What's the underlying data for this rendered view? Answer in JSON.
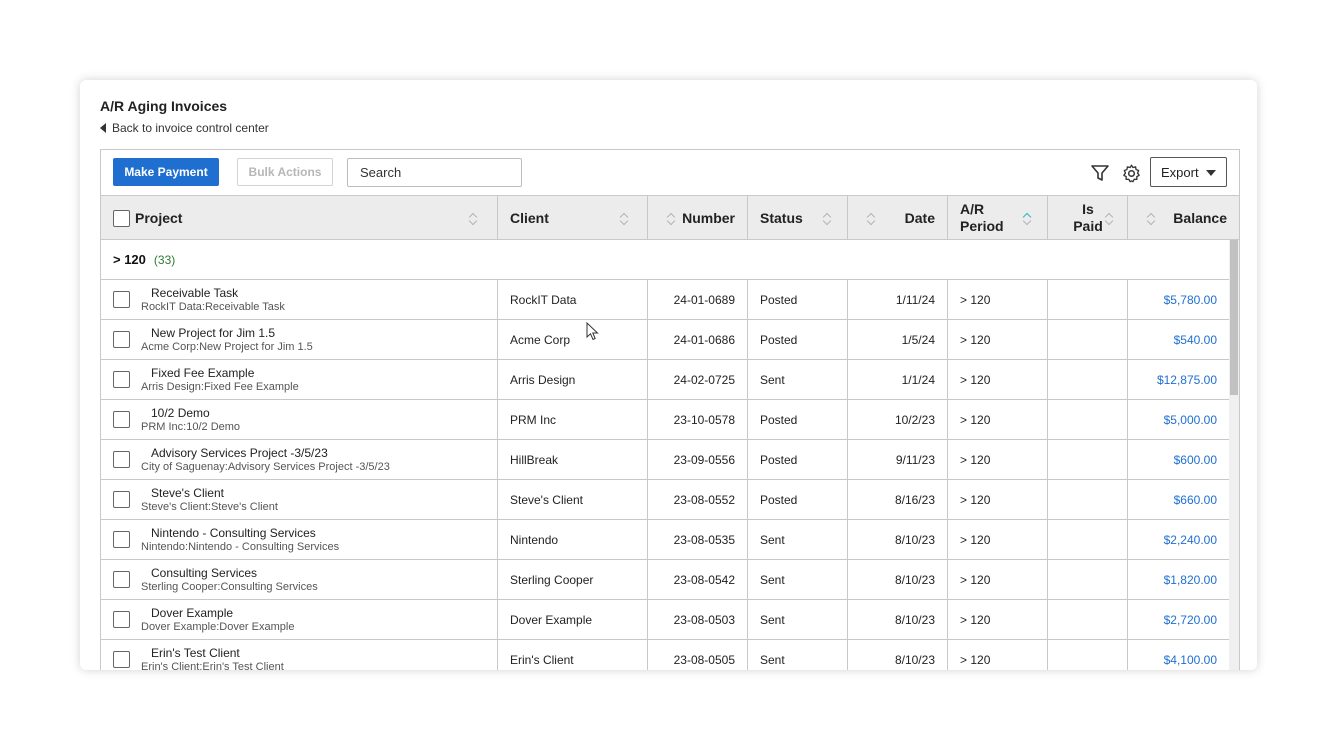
{
  "page": {
    "title": "A/R Aging Invoices",
    "back_link": "Back to invoice control center"
  },
  "toolbar": {
    "make_payment": "Make Payment",
    "bulk_actions": "Bulk Actions",
    "search_placeholder": "Search",
    "export": "Export",
    "icons": [
      "filter-icon",
      "gear-icon",
      "chevron-down-icon"
    ]
  },
  "columns": {
    "project": "Project",
    "client": "Client",
    "number": "Number",
    "status": "Status",
    "date": "Date",
    "ar_period": "A/R Period",
    "is_paid": "Is Paid",
    "balance": "Balance"
  },
  "group": {
    "label": "> 120",
    "count": "(33)"
  },
  "rows": [
    {
      "project": "Receivable Task",
      "path": "RockIT Data:Receivable Task",
      "client": "RockIT Data",
      "number": "24-01-0689",
      "status": "Posted",
      "date": "1/11/24",
      "period": "> 120",
      "paid": "",
      "balance": "$5,780.00"
    },
    {
      "project": "New Project for Jim 1.5",
      "path": "Acme Corp:New Project for Jim 1.5",
      "client": "Acme Corp",
      "number": "24-01-0686",
      "status": "Posted",
      "date": "1/5/24",
      "period": "> 120",
      "paid": "",
      "balance": "$540.00"
    },
    {
      "project": "Fixed Fee Example",
      "path": "Arris Design:Fixed Fee Example",
      "client": "Arris Design",
      "number": "24-02-0725",
      "status": "Sent",
      "date": "1/1/24",
      "period": "> 120",
      "paid": "",
      "balance": "$12,875.00"
    },
    {
      "project": "10/2 Demo",
      "path": "PRM Inc:10/2 Demo",
      "client": "PRM Inc",
      "number": "23-10-0578",
      "status": "Posted",
      "date": "10/2/23",
      "period": "> 120",
      "paid": "",
      "balance": "$5,000.00"
    },
    {
      "project": "Advisory Services Project -3/5/23",
      "path": "City of Saguenay:Advisory Services Project -3/5/23",
      "client": "HillBreak",
      "number": "23-09-0556",
      "status": "Posted",
      "date": "9/11/23",
      "period": "> 120",
      "paid": "",
      "balance": "$600.00"
    },
    {
      "project": "Steve's Client",
      "path": "Steve's Client:Steve's Client",
      "client": "Steve's Client",
      "number": "23-08-0552",
      "status": "Posted",
      "date": "8/16/23",
      "period": "> 120",
      "paid": "",
      "balance": "$660.00"
    },
    {
      "project": "Nintendo - Consulting Services",
      "path": "Nintendo:Nintendo - Consulting Services",
      "client": "Nintendo",
      "number": "23-08-0535",
      "status": "Sent",
      "date": "8/10/23",
      "period": "> 120",
      "paid": "",
      "balance": "$2,240.00"
    },
    {
      "project": "Consulting Services",
      "path": "Sterling Cooper:Consulting Services",
      "client": "Sterling Cooper",
      "number": "23-08-0542",
      "status": "Sent",
      "date": "8/10/23",
      "period": "> 120",
      "paid": "",
      "balance": "$1,820.00"
    },
    {
      "project": "Dover Example",
      "path": "Dover Example:Dover Example",
      "client": "Dover Example",
      "number": "23-08-0503",
      "status": "Sent",
      "date": "8/10/23",
      "period": "> 120",
      "paid": "",
      "balance": "$2,720.00"
    },
    {
      "project": "Erin's Test Client",
      "path": "Erin's Client:Erin's Test Client",
      "client": "Erin's Client",
      "number": "23-08-0505",
      "status": "Sent",
      "date": "8/10/23",
      "period": "> 120",
      "paid": "",
      "balance": "$4,100.00"
    }
  ],
  "colors": {
    "primary": "#1f6fd1",
    "sort_active": "#2ab5c7",
    "group_count": "#2e7d32"
  }
}
